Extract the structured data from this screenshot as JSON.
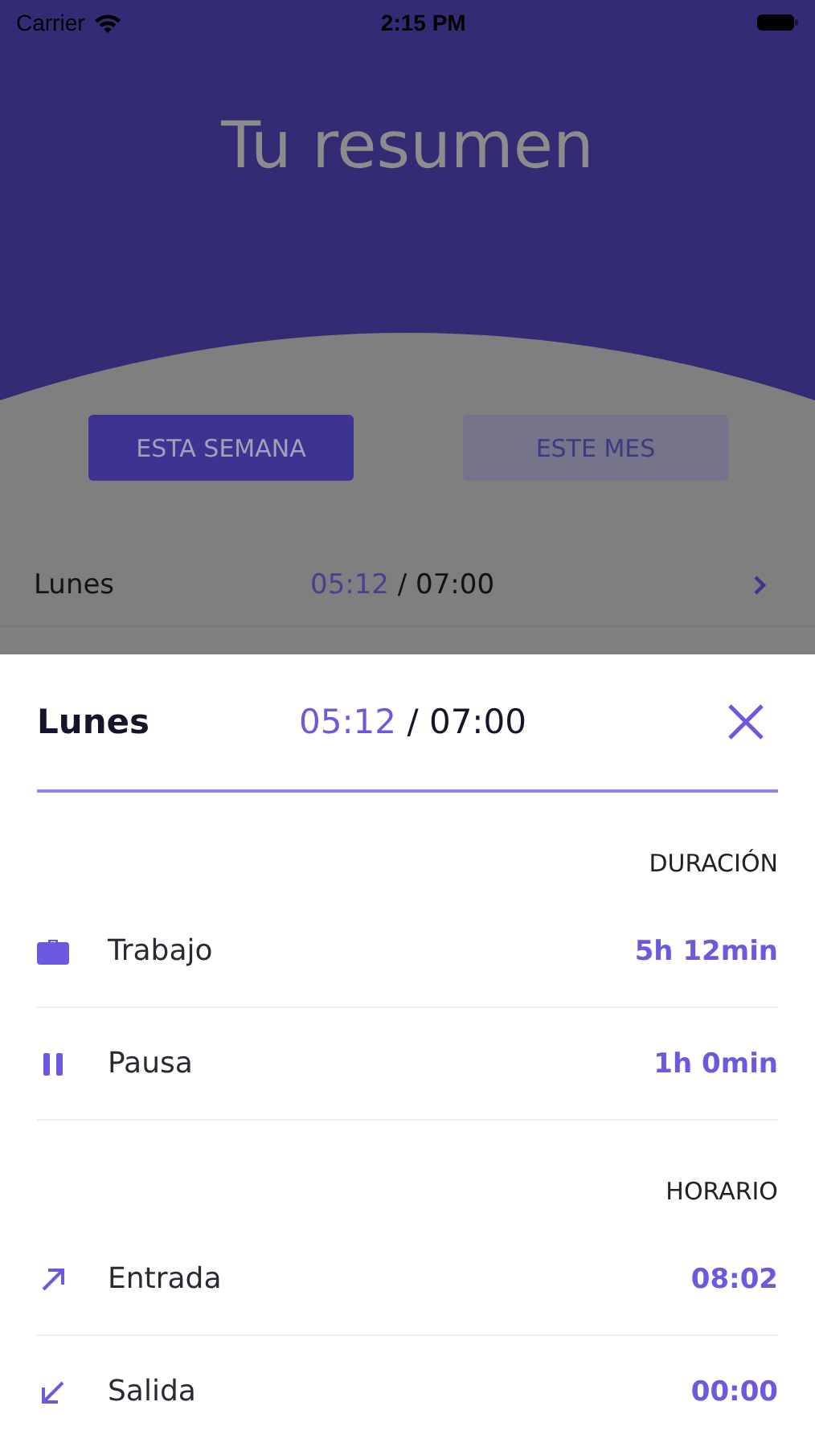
{
  "status_bar": {
    "carrier": "Carrier",
    "time": "2:15 PM"
  },
  "title": "Tu resumen",
  "tabs": [
    {
      "label": "ESTA SEMANA",
      "selected": true
    },
    {
      "label": "ESTE MES",
      "selected": false
    }
  ],
  "day_row": {
    "day": "Lunes",
    "worked": "05:12",
    "separator": "/ ",
    "target": "07:00"
  },
  "sheet": {
    "day": "Lunes",
    "worked": "05:12",
    "separator": "/ ",
    "target": "07:00",
    "sections": [
      {
        "heading": "DURACIÓN",
        "rows": [
          {
            "kind": "work",
            "label": "Trabajo",
            "value": "5h 12min"
          },
          {
            "kind": "pause",
            "label": "Pausa",
            "value": "1h 0min"
          }
        ]
      },
      {
        "heading": "HORARIO",
        "rows": [
          {
            "kind": "in",
            "label": "Entrada",
            "value": "08:02"
          },
          {
            "kind": "out",
            "label": "Salida",
            "value": "00:00"
          }
        ]
      }
    ]
  }
}
